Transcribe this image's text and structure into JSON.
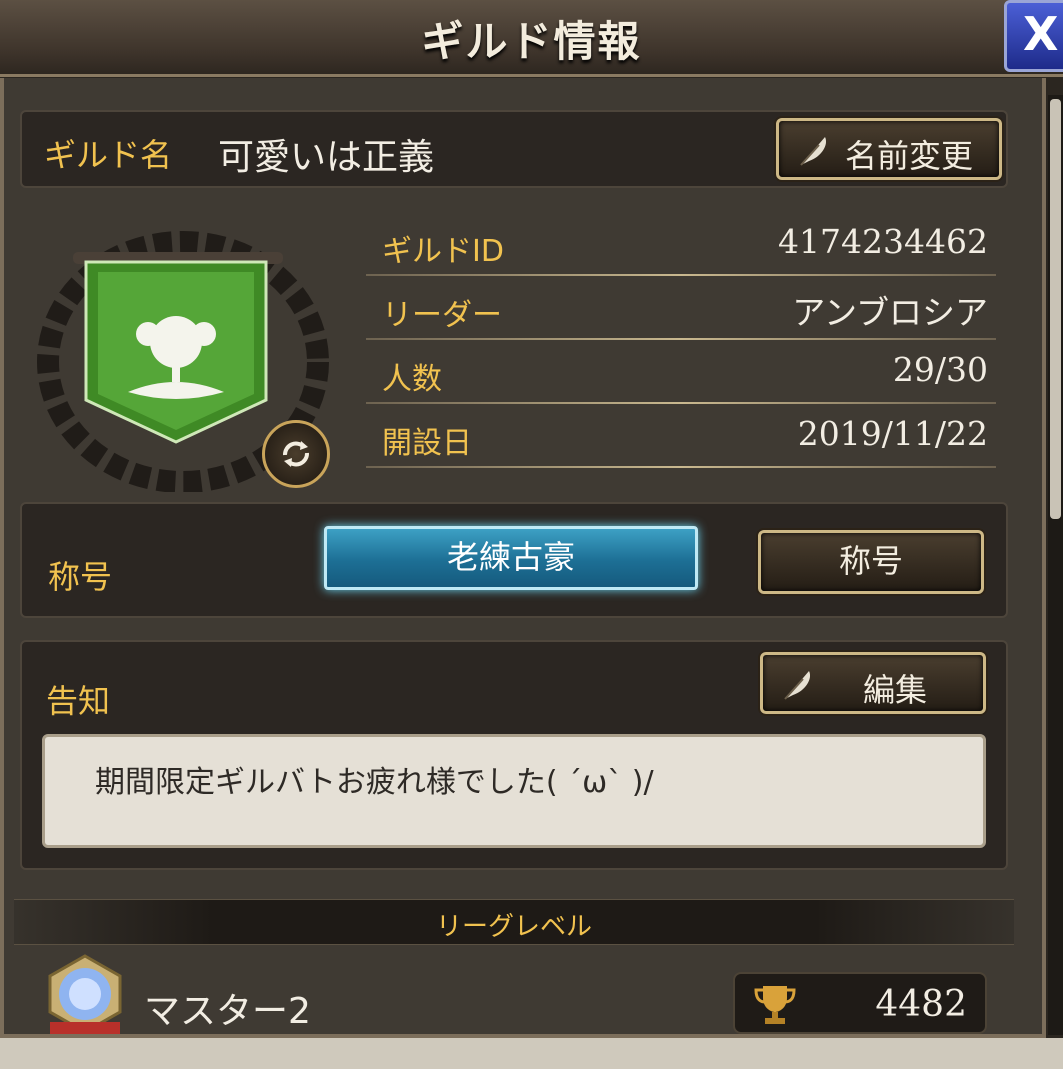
{
  "header": {
    "title": "ギルド情報",
    "close_label": "X"
  },
  "guild_name": {
    "label": "ギルド名",
    "value": "可愛いは正義",
    "rename_button": "名前変更"
  },
  "info": {
    "rows": [
      {
        "label": "ギルドID",
        "value": "4174234462"
      },
      {
        "label": "リーダー",
        "value": "アンブロシア"
      },
      {
        "label": "人数",
        "value": "29/30"
      },
      {
        "label": "開設日",
        "value": "2019/11/22"
      }
    ]
  },
  "title_section": {
    "label": "称号",
    "badge": "老練古豪",
    "button": "称号"
  },
  "notice": {
    "label": "告知",
    "edit_button": "編集",
    "text": "期間限定ギルバトお疲れ様でした( ´ω` )/"
  },
  "league": {
    "heading": "リーグレベル",
    "rank": "マスター2",
    "points": "4482"
  },
  "colors": {
    "gold": "#f1c24f",
    "banner_green": "#3f8a25",
    "badge_blue": "#1d6f95",
    "close_blue": "#2f3fb8"
  },
  "icons": [
    "quill-icon",
    "refresh-icon",
    "trophy-icon",
    "crystal-emblem-icon",
    "laurel-wreath-icon",
    "guild-banner-icon"
  ]
}
